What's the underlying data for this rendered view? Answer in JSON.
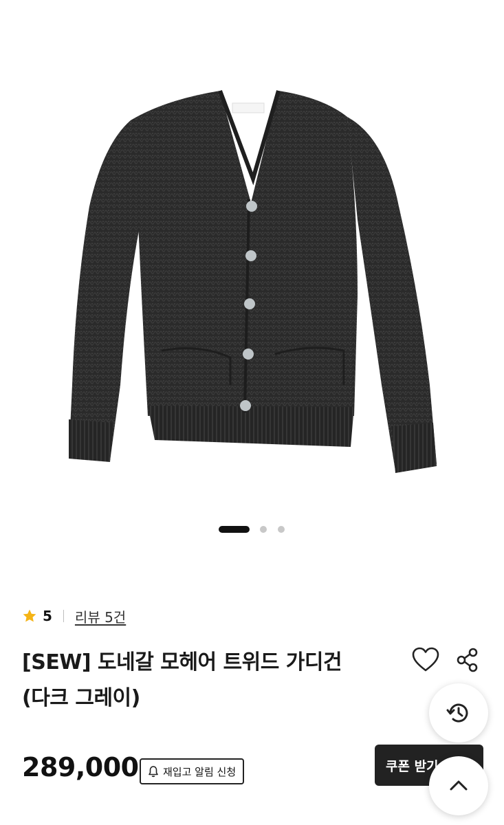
{
  "product": {
    "rating": "5",
    "review_link": "리뷰 5건",
    "title_line1": "[SEW] 도네갈 모헤어 트위드 가디건",
    "title_line2": "(다크 그레이)",
    "price": "289,000",
    "restock_label": "재입고 알림 신청",
    "coupon_label": "쿠폰 받기"
  },
  "carousel": {
    "total_slides": 3,
    "active_index": 0
  },
  "colors": {
    "star": "#f5b416",
    "knit": "#2b2b2b",
    "coupon_bg": "#222222"
  },
  "icons": {
    "star": "star-icon",
    "heart": "heart-icon",
    "share": "share-icon",
    "history": "history-icon",
    "top": "chevron-up-icon",
    "bell": "bell-icon",
    "download": "download-icon"
  }
}
